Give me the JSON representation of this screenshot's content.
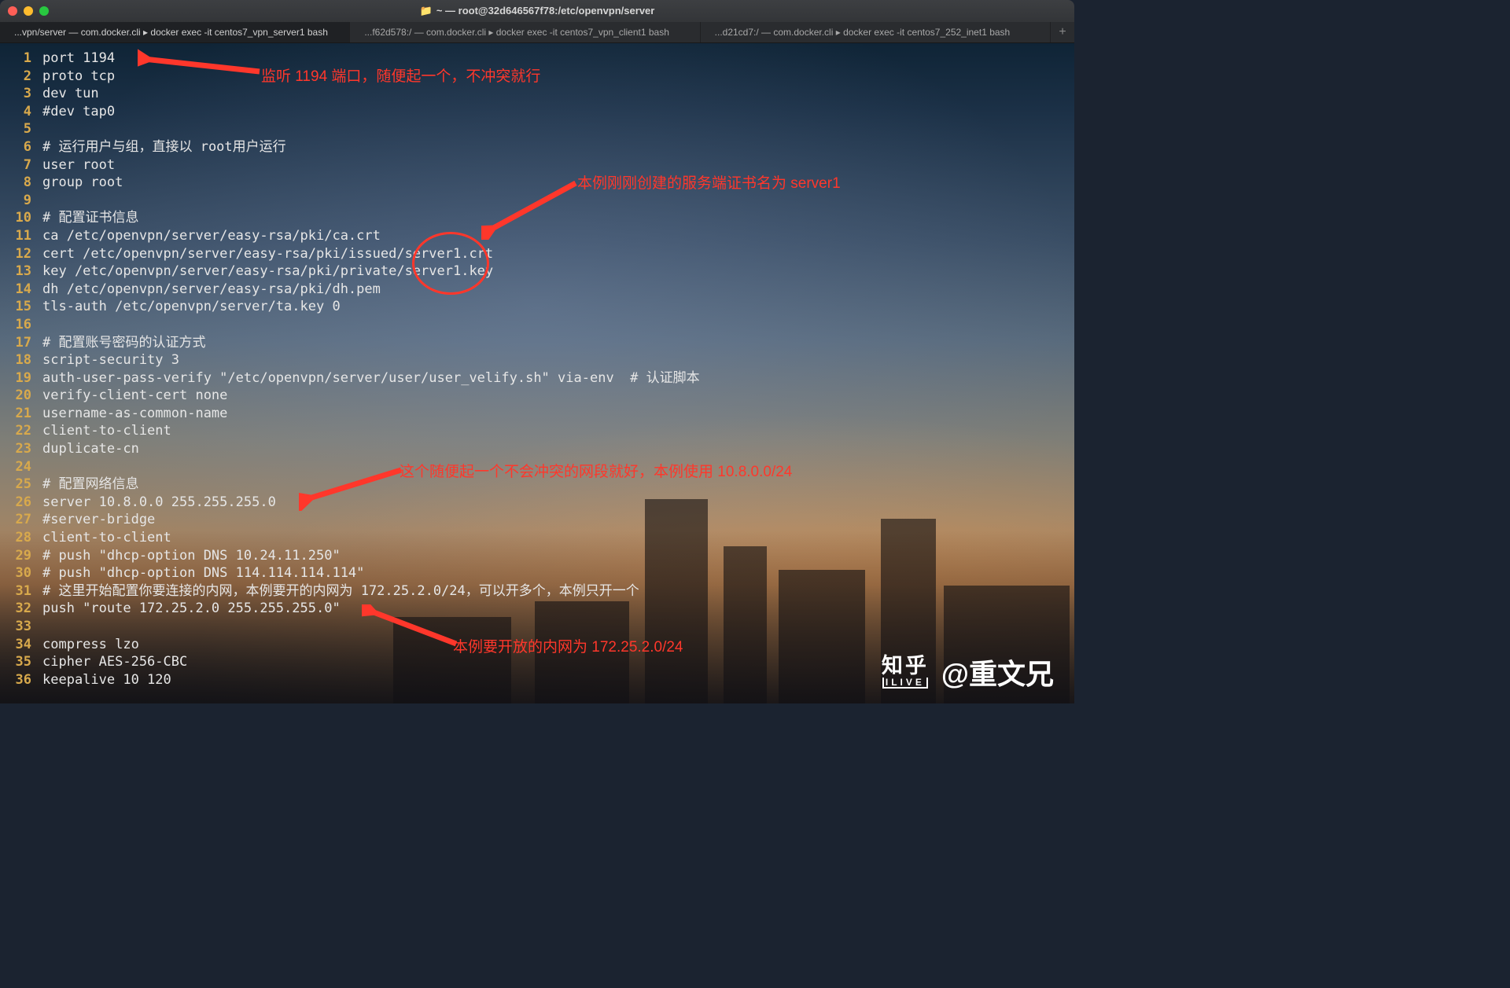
{
  "window": {
    "title": "~ — root@32d646567f78:/etc/openvpn/server"
  },
  "tabs": [
    {
      "label": "...vpn/server — com.docker.cli ▸ docker exec -it centos7_vpn_server1 bash",
      "active": true
    },
    {
      "label": "...f62d578:/ — com.docker.cli ▸ docker exec -it centos7_vpn_client1 bash",
      "active": false
    },
    {
      "label": "...d21cd7:/ — com.docker.cli ▸ docker exec -it centos7_252_inet1 bash",
      "active": false
    }
  ],
  "lines": [
    "port 1194",
    "proto tcp",
    "dev tun",
    "#dev tap0",
    "",
    "# 运行用户与组，直接以 root用户运行",
    "user root",
    "group root",
    "",
    "# 配置证书信息",
    "ca /etc/openvpn/server/easy-rsa/pki/ca.crt",
    "cert /etc/openvpn/server/easy-rsa/pki/issued/server1.crt",
    "key /etc/openvpn/server/easy-rsa/pki/private/server1.key",
    "dh /etc/openvpn/server/easy-rsa/pki/dh.pem",
    "tls-auth /etc/openvpn/server/ta.key 0",
    "",
    "# 配置账号密码的认证方式",
    "script-security 3",
    "auth-user-pass-verify \"/etc/openvpn/server/user/user_velify.sh\" via-env  # 认证脚本",
    "verify-client-cert none",
    "username-as-common-name",
    "client-to-client",
    "duplicate-cn",
    "",
    "# 配置网络信息",
    "server 10.8.0.0 255.255.255.0",
    "#server-bridge",
    "client-to-client",
    "# push \"dhcp-option DNS 10.24.11.250\"",
    "# push \"dhcp-option DNS 114.114.114.114\"",
    "# 这里开始配置你要连接的内网，本例要开的内网为 172.25.2.0/24，可以开多个，本例只开一个",
    "push \"route 172.25.2.0 255.255.255.0\"",
    "",
    "compress lzo",
    "cipher AES-256-CBC",
    "keepalive 10 120"
  ],
  "annotations": {
    "a1": "监听 1194 端口，随便起一个，不冲突就行",
    "a2": "本例刚刚创建的服务端证书名为 server1",
    "a3": "这个随便起一个不会冲突的网段就好，本例使用 10.8.0.0/24",
    "a4": "本例要开放的内网为 172.25.2.0/24"
  },
  "watermark": {
    "site_line1": "知乎",
    "site_line2": "ILIVE",
    "author": "@重文兄"
  },
  "colors": {
    "annotation_red": "#ff372b",
    "line_number": "#d8a94c"
  }
}
